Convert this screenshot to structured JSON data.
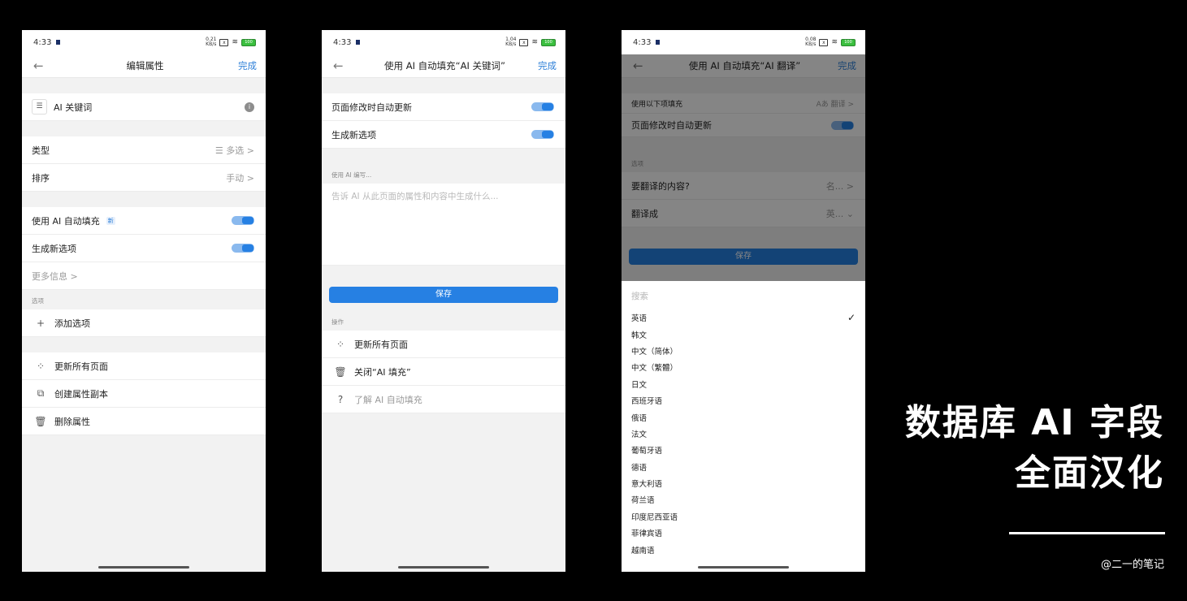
{
  "status_time": "4:33",
  "battery": "100",
  "p1": {
    "rate": [
      "0.21",
      "KB/s"
    ],
    "nav": {
      "title": "编辑属性",
      "done": "完成"
    },
    "property_name": "AI 关键词",
    "rows": {
      "type_label": "类型",
      "type_value": "☰ 多选 >",
      "sort_label": "排序",
      "sort_value": "手动 >"
    },
    "ai_fill_label": "使用 AI 自动填充",
    "ai_fill_badge": "新",
    "gen_options_label": "生成新选项",
    "more_info": "更多信息 >",
    "options_section": "选项",
    "add_option": "添加选项",
    "actions": [
      "更新所有页面",
      "创建属性副本",
      "删除属性"
    ]
  },
  "p2": {
    "rate": [
      "1.04",
      "KB/s"
    ],
    "nav": {
      "title": "使用 AI 自动填充“AI 关键词”",
      "done": "完成"
    },
    "auto_update": "页面修改时自动更新",
    "gen_options": "生成新选项",
    "prompt_label": "使用 AI 编写...",
    "prompt_placeholder": "告诉 AI 从此页面的属性和内容中生成什么...",
    "save": "保存",
    "actions_label": "操作",
    "actions": [
      "更新所有页面",
      "关闭“AI 填充”",
      "了解 AI 自动填充"
    ]
  },
  "p3": {
    "rate": [
      "0.08",
      "KB/s"
    ],
    "nav": {
      "title": "使用 AI 自动填充“AI 翻译”",
      "done": "完成"
    },
    "fill_with_label": "使用以下项填充",
    "fill_with_value": "A⁠あ 翻译 >",
    "auto_update": "页面修改时自动更新",
    "options_section": "选项",
    "translate_what": "要翻译的内容?",
    "translate_what_value": "名... >",
    "translate_to": "翻译成",
    "translate_to_value": "英... ⌄",
    "save": "保存",
    "search_placeholder": "搜索",
    "languages": [
      "英语",
      "韩文",
      "中文（简体）",
      "中文（繁體）",
      "日文",
      "西班牙语",
      "俄语",
      "法文",
      "葡萄牙语",
      "德语",
      "意大利语",
      "荷兰语",
      "印度尼西亚语",
      "菲律宾语",
      "越南语"
    ],
    "selected_language": "英语"
  },
  "side": {
    "headline_line1": "数据库 AI 字段",
    "headline_line2": "全面汉化",
    "credit": "@二一的笔记"
  }
}
